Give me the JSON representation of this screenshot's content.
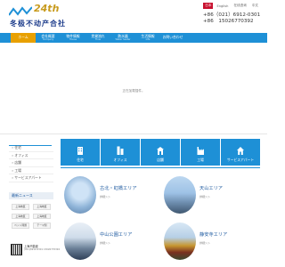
{
  "header": {
    "logo_number": "24th",
    "company_name": "冬极不动产合社",
    "lang_links": [
      {
        "label": "日本",
        "active": true
      },
      {
        "label": "English",
        "active": false
      },
      {
        "label": "在线咨询",
        "active": false
      },
      {
        "label": "中文",
        "active": false
      }
    ],
    "phones": [
      "+86（021）6912-0301",
      "+86　15026770392"
    ]
  },
  "nav": [
    {
      "title": "ホーム",
      "sub": "",
      "active": true
    },
    {
      "title": "会社概要",
      "sub": "Company",
      "active": false
    },
    {
      "title": "物件情報",
      "sub": "House",
      "active": false
    },
    {
      "title": "賃貸流れ",
      "sub": "Flow",
      "active": false
    },
    {
      "title": "熱水器",
      "sub": "Water heater",
      "active": false
    },
    {
      "title": "生活情報",
      "sub": "Life",
      "active": false
    },
    {
      "title": "お問い合わせ",
      "sub": "",
      "active": false
    }
  ],
  "banner": {
    "message": "正在加载插件。"
  },
  "sidebar": {
    "heading": "",
    "items": [
      "住宅",
      "オフィス",
      "店舗",
      "工場",
      "サービスアパート"
    ],
    "news_heading": "最新ニュース",
    "news_buttons": [
      "上海地区",
      "上海地区",
      "上海地区",
      "上海地区",
      "ペット問題",
      "テーマ別"
    ],
    "qr_name": "上海不動産",
    "qr_sub": "(021)6912-0301 15026770392"
  },
  "services": [
    {
      "label": "住宅",
      "icon": "building-icon"
    },
    {
      "label": "オフィス",
      "icon": "office-icon"
    },
    {
      "label": "店舗",
      "icon": "store-icon"
    },
    {
      "label": "工場",
      "icon": "factory-icon"
    },
    {
      "label": "サービスアパート",
      "icon": "apartment-icon"
    }
  ],
  "areas": [
    {
      "title": "古北・虹橋エリア",
      "more": "詳細＞＞"
    },
    {
      "title": "天山エリア",
      "more": "詳細＞＞"
    },
    {
      "title": "中山公園エリア",
      "more": "詳細＞＞"
    },
    {
      "title": "静安寺エリア",
      "more": "詳細＞＞"
    }
  ],
  "colors": {
    "primary": "#1e90d6",
    "accent": "#e8a000",
    "brand_red": "#c8102e"
  }
}
